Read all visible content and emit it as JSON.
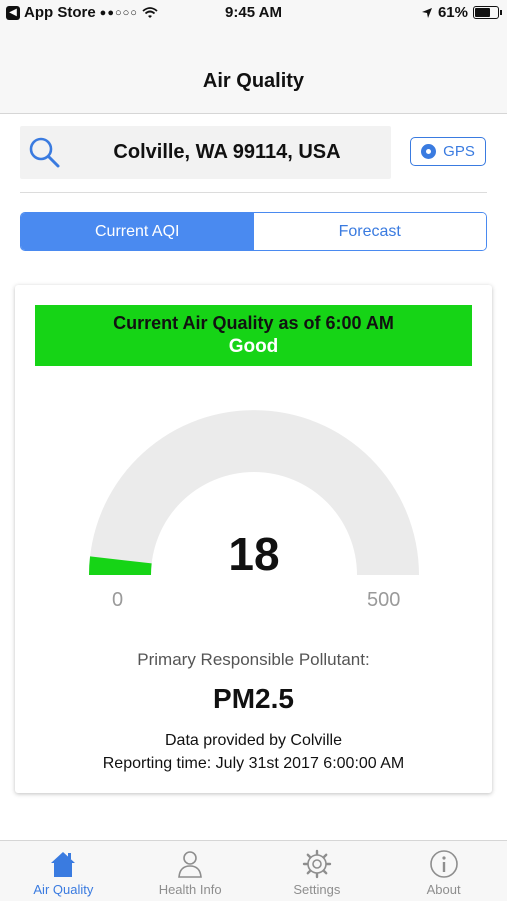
{
  "status_bar": {
    "back_app": "App Store",
    "time": "9:45 AM",
    "battery": "61%",
    "battery_level": 0.61
  },
  "nav": {
    "title": "Air Quality"
  },
  "search": {
    "location": "Colville, WA 99114, USA",
    "gps_label": "GPS"
  },
  "segments": {
    "current": "Current AQI",
    "forecast": "Forecast",
    "selected": "current"
  },
  "aqi": {
    "banner_title": "Current Air Quality as of 6:00 AM",
    "category": "Good",
    "category_color": "#16d416",
    "value": "18",
    "scale_min": "0",
    "scale_max": "500",
    "pollutant_label": "Primary Responsible Pollutant:",
    "pollutant": "PM2.5",
    "provider": "Data provided by Colville",
    "reporting_time": "Reporting time: July 31st 2017 6:00:00 AM"
  },
  "tabs": [
    {
      "label": "Air Quality",
      "icon": "house-icon",
      "active": true
    },
    {
      "label": "Health Info",
      "icon": "person-icon",
      "active": false
    },
    {
      "label": "Settings",
      "icon": "gear-icon",
      "active": false
    },
    {
      "label": "About",
      "icon": "info-icon",
      "active": false
    }
  ],
  "colors": {
    "accent": "#3a7be0",
    "good": "#16d416"
  }
}
